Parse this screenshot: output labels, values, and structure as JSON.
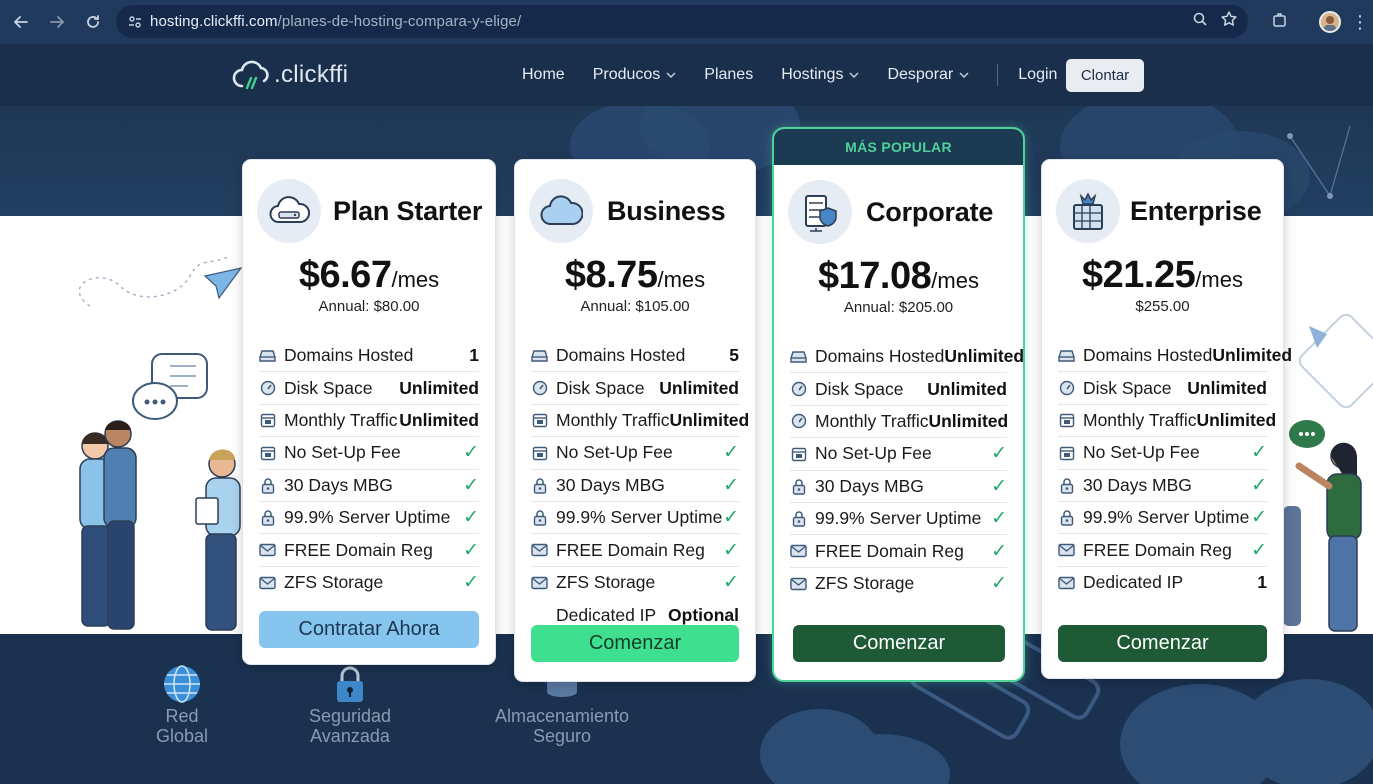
{
  "browser": {
    "url_host": "hosting.clickffi.com",
    "url_path": "/planes-de-hosting-compara-y-elige/"
  },
  "site": {
    "logo_text": ".clickffi",
    "menu": [
      {
        "label": "Home",
        "dropdown": false
      },
      {
        "label": "Producos",
        "dropdown": true
      },
      {
        "label": "Planes",
        "dropdown": false
      },
      {
        "label": "Hostings",
        "dropdown": true
      },
      {
        "label": "Desporar",
        "dropdown": true
      }
    ],
    "login_label": "Login",
    "contact_label": "Clontar"
  },
  "plans": [
    {
      "name": "Plan Starter",
      "icon": "server-cloud-icon",
      "price": "$6.67",
      "period": "/mes",
      "annual": "Annual: $80.00",
      "cta": "Contratar Ahora",
      "cta_style": "light",
      "features": [
        {
          "icon": "drive-icon",
          "label": "Domains Hosted",
          "value": "1"
        },
        {
          "icon": "gauge-icon",
          "label": "Disk Space",
          "value": "Unlimited"
        },
        {
          "icon": "calendar-icon",
          "label": "Monthly Traffic",
          "value": "Unlimited"
        },
        {
          "icon": "calendar-icon",
          "label": "No Set-Up Fee",
          "value": "✓"
        },
        {
          "icon": "lock-icon",
          "label": "30 Days MBG",
          "value": "✓"
        },
        {
          "icon": "lock-icon",
          "label": "99.9% Server Uptime",
          "value": "✓"
        },
        {
          "icon": "mail-icon",
          "label": "FREE Domain Reg",
          "value": "✓"
        },
        {
          "icon": "mail-icon",
          "label": "ZFS Storage",
          "value": "✓"
        }
      ]
    },
    {
      "name": "Business",
      "icon": "cloud-icon",
      "price": "$8.75",
      "period": "/mes",
      "annual": "Annual: $105.00",
      "cta": "Comenzar",
      "cta_style": "mint",
      "features": [
        {
          "icon": "drive-icon",
          "label": "Domains Hosted",
          "value": "5"
        },
        {
          "icon": "gauge-icon",
          "label": "Disk Space",
          "value": "Unlimited"
        },
        {
          "icon": "calendar-icon",
          "label": "Monthly Traffic",
          "value": "Unlimited"
        },
        {
          "icon": "calendar-icon",
          "label": "No Set-Up Fee",
          "value": "✓"
        },
        {
          "icon": "lock-icon",
          "label": "30 Days MBG",
          "value": "✓"
        },
        {
          "icon": "lock-icon",
          "label": "99.9% Server Uptime",
          "value": "✓"
        },
        {
          "icon": "mail-icon",
          "label": "FREE Domain Reg",
          "value": "✓"
        },
        {
          "icon": "mail-icon",
          "label": "ZFS Storage",
          "value": "✓"
        },
        {
          "icon": "",
          "label": "Dedicated IP",
          "value": "Optional"
        }
      ]
    },
    {
      "name": "Corporate",
      "icon": "server-shield-icon",
      "badge": "MÁS POPULAR",
      "price": "$17.08",
      "period": "/mes",
      "annual": "Annual: $205.00",
      "cta": "Comenzar",
      "cta_style": "dark",
      "features": [
        {
          "icon": "drive-icon",
          "label": "Domains Hosted",
          "value": "Unlimited"
        },
        {
          "icon": "gauge-icon",
          "label": "Disk Space",
          "value": "Unlimited"
        },
        {
          "icon": "gauge-icon",
          "label": "Monthly Traffic",
          "value": "Unlimited"
        },
        {
          "icon": "calendar-icon",
          "label": "No Set-Up Fee",
          "value": "✓"
        },
        {
          "icon": "lock-icon",
          "label": "30 Days MBG",
          "value": "✓"
        },
        {
          "icon": "lock-icon",
          "label": "99.9% Server Uptime",
          "value": "✓"
        },
        {
          "icon": "mail-icon",
          "label": "FREE Domain Reg",
          "value": "✓"
        },
        {
          "icon": "mail-icon",
          "label": "ZFS Storage",
          "value": "✓"
        }
      ]
    },
    {
      "name": "Enterprise",
      "icon": "server-crown-icon",
      "price": "$21.25",
      "period": "/mes",
      "annual": "$255.00",
      "cta": "Comenzar",
      "cta_style": "dark",
      "features": [
        {
          "icon": "drive-icon",
          "label": "Domains Hosted",
          "value": "Unlimited"
        },
        {
          "icon": "gauge-icon",
          "label": "Disk Space",
          "value": "Unlimited"
        },
        {
          "icon": "calendar-icon",
          "label": "Monthly Traffic",
          "value": "Unlimited"
        },
        {
          "icon": "calendar-icon",
          "label": "No Set-Up Fee",
          "value": "✓"
        },
        {
          "icon": "lock-icon",
          "label": "30 Days MBG",
          "value": "✓"
        },
        {
          "icon": "lock-icon",
          "label": "99.9% Server Uptime",
          "value": "✓"
        },
        {
          "icon": "mail-icon",
          "label": "FREE Domain Reg",
          "value": "✓"
        },
        {
          "icon": "mail-icon",
          "label": "Dedicated IP",
          "value": "1"
        }
      ]
    }
  ],
  "features_strip": [
    {
      "icon": "globe-icon",
      "line1": "Red",
      "line2": "Global"
    },
    {
      "icon": "padlock-icon",
      "line1": "Seguridad",
      "line2": "Avanzada"
    },
    {
      "icon": "database-icon",
      "line1": "Almacenamiento",
      "line2": "Seguro"
    }
  ],
  "colors": {
    "accent_green": "#4fd19a",
    "cta_light": "#86c6ee",
    "cta_mint": "#3ee08f",
    "cta_dark": "#1d5a35",
    "check": "#23a86a",
    "navy": "#1a2f4b"
  }
}
